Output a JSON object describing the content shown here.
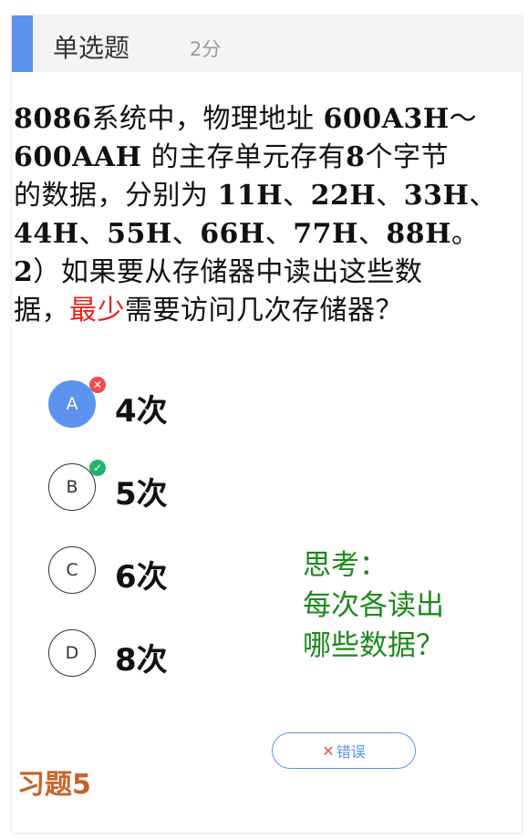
{
  "header": {
    "title": "单选题",
    "score": "2分"
  },
  "question": {
    "lines": [
      [
        {
          "t": "8086",
          "b": true
        },
        {
          "t": "系统中，物理地址 "
        },
        {
          "t": "600A3H",
          "b": true
        },
        {
          "t": "～"
        }
      ],
      [
        {
          "t": "600AAH",
          "b": true
        },
        {
          "t": " 的主存单元存有"
        },
        {
          "t": "8",
          "b": true
        },
        {
          "t": "个字节"
        }
      ],
      [
        {
          "t": "的数据，分别为 "
        },
        {
          "t": "11H",
          "b": true
        },
        {
          "t": "、"
        },
        {
          "t": "22H",
          "b": true
        },
        {
          "t": "、"
        },
        {
          "t": "33H",
          "b": true
        },
        {
          "t": "、"
        }
      ],
      [
        {
          "t": "44H",
          "b": true
        },
        {
          "t": "、"
        },
        {
          "t": "55H",
          "b": true
        },
        {
          "t": "、"
        },
        {
          "t": "66H",
          "b": true
        },
        {
          "t": "、"
        },
        {
          "t": "77H",
          "b": true
        },
        {
          "t": "、"
        },
        {
          "t": "88H",
          "b": true
        },
        {
          "t": "。"
        }
      ],
      [
        {
          "t": "2",
          "b": true
        },
        {
          "t": "）如果要从存储器中读出这些数"
        }
      ],
      [
        {
          "t": "据，"
        },
        {
          "t": "最少",
          "red": true
        },
        {
          "t": "需要访问几次存储器？"
        }
      ]
    ]
  },
  "options": [
    {
      "letter": "A",
      "text": "4次",
      "selected": true,
      "mark": "wrong",
      "mark_symbol": "✕"
    },
    {
      "letter": "B",
      "text": "5次",
      "selected": false,
      "mark": "right",
      "mark_symbol": "✓"
    },
    {
      "letter": "C",
      "text": "6次",
      "selected": false,
      "mark": "",
      "mark_symbol": ""
    },
    {
      "letter": "D",
      "text": "8次",
      "selected": false,
      "mark": "",
      "mark_symbol": ""
    }
  ],
  "think_note": [
    "思考：",
    "每次各读出",
    "哪些数据？"
  ],
  "exercise_label": "习题5",
  "error_button": {
    "icon": "close-icon",
    "x_symbol": "✕",
    "label": "错误"
  },
  "colors": {
    "accent": "#5b93ee",
    "wrong": "#ee4d4d",
    "right": "#23b36b",
    "highlight": "#e8231b",
    "note": "#1a8a1a",
    "exercise": "#c9622a"
  }
}
